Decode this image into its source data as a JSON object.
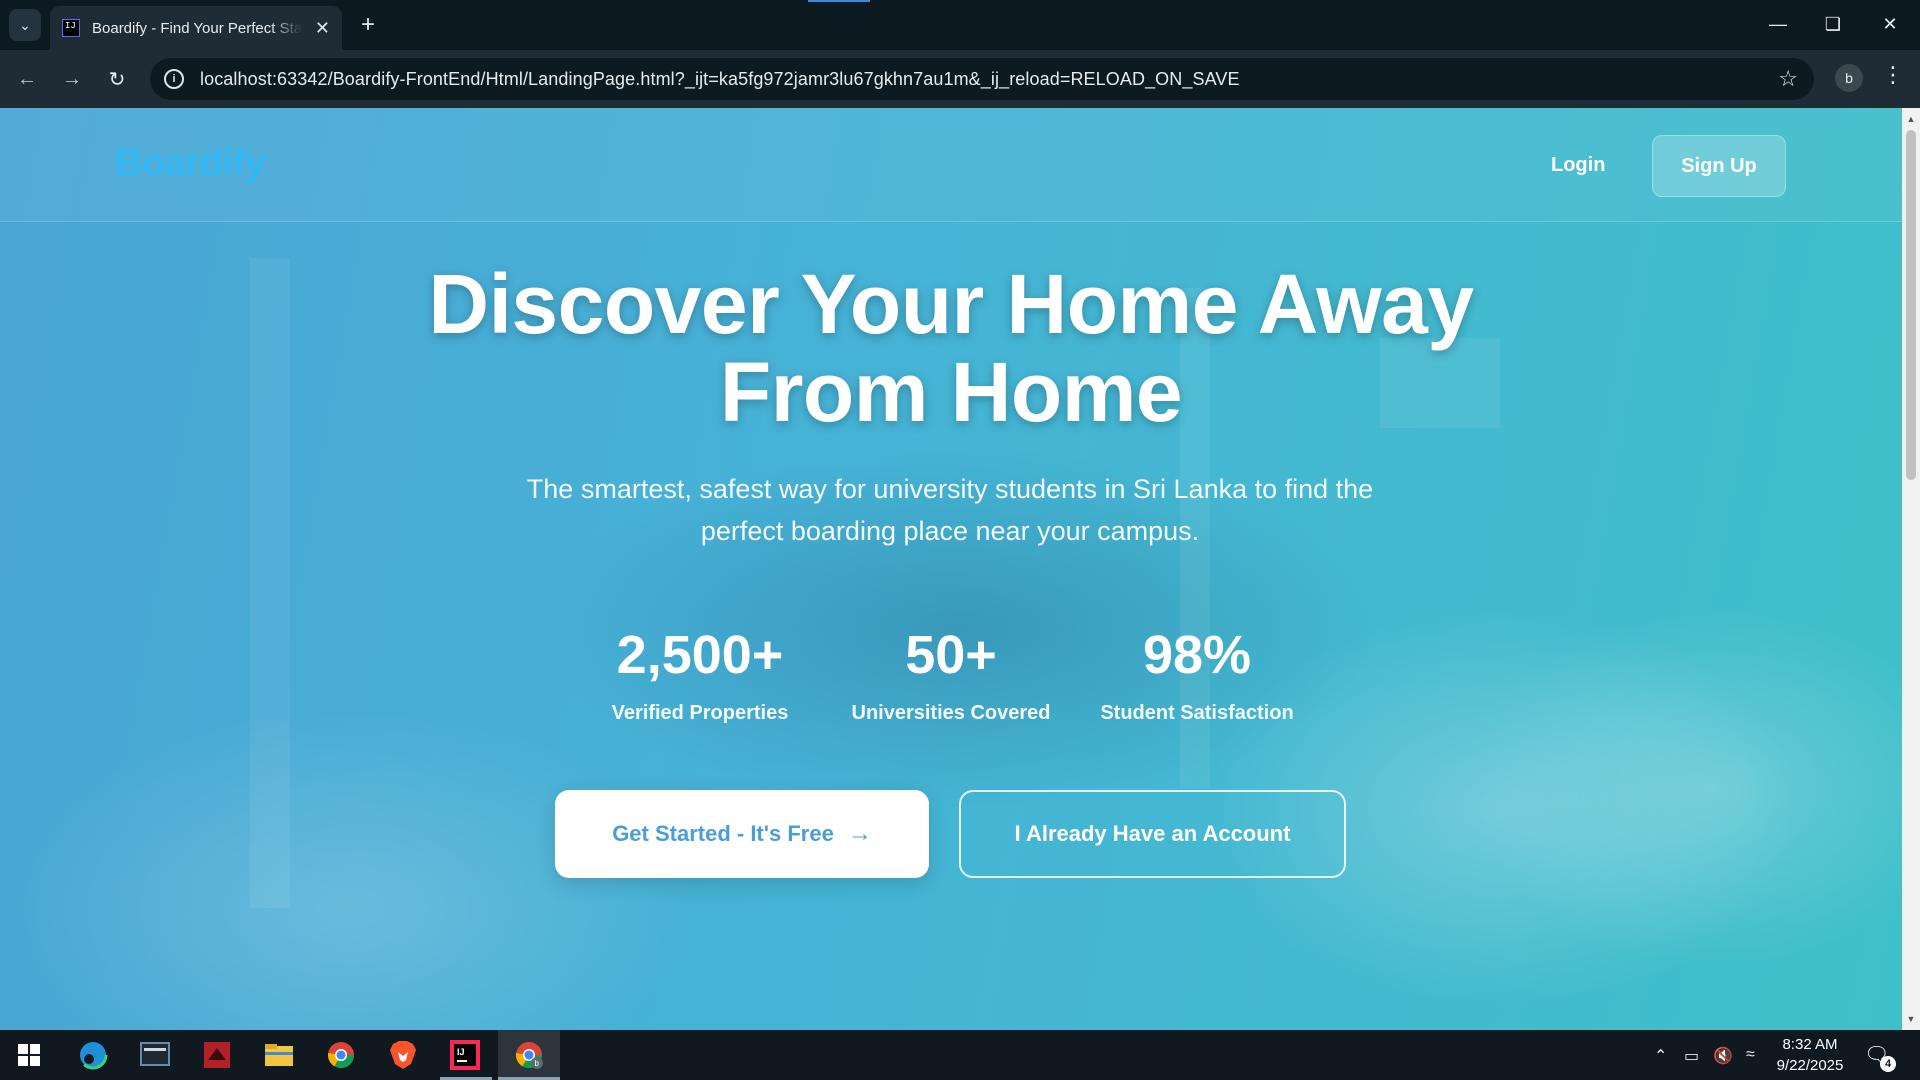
{
  "browser": {
    "tab_title": "Boardify - Find Your Perfect Stay",
    "favicon_text": "IJ",
    "tab_close": "✕",
    "new_tab": "+",
    "url": "localhost:63342/Boardify-FrontEnd/Html/LandingPage.html?_ijt=ka5fg972jamr3lu67gkhn7au1m&_ij_reload=RELOAD_ON_SAVE",
    "profile_initial": "b",
    "icons": {
      "back": "back-arrow-icon",
      "forward": "forward-arrow-icon",
      "reload": "reload-icon",
      "info": "site-info-icon",
      "star": "bookmark-star-icon",
      "menu": "kebab-menu-icon"
    }
  },
  "page": {
    "brand": "Boardify",
    "nav": {
      "login": "Login",
      "signup": "Sign Up"
    },
    "hero": {
      "title_line1": "Discover Your Home Away",
      "title_line2": "From Home",
      "subtitle": "The smartest, safest way for university students in Sri Lanka to find the perfect boarding place near your campus."
    },
    "stats": [
      {
        "value": "2,500+",
        "label": "Verified Properties"
      },
      {
        "value": "50+",
        "label": "Universities Covered"
      },
      {
        "value": "98%",
        "label": "Student Satisfaction"
      }
    ],
    "cta": {
      "primary": "Get Started - It's Free",
      "secondary": "I Already Have an Account"
    },
    "colors": {
      "brand": "#2fb8f5",
      "primary_button_text": "#4a9ed8"
    }
  },
  "taskbar": {
    "time": "8:32 AM",
    "date": "9/22/2025",
    "notification_count": "4"
  }
}
